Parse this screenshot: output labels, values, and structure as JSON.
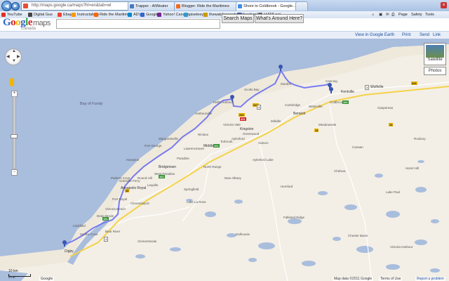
{
  "browser": {
    "address": "http://maps.google.ca/maps?hl=en&tab=wl",
    "tabs": [
      {
        "label": "Trapper - AIWeater",
        "color": "#4a78c0"
      },
      {
        "label": "Blogger: Ride the Maritimes",
        "color": "#f26b1d"
      },
      {
        "label": "Shore to Coldbrook - Google...",
        "color": "#3d8ee6"
      }
    ],
    "favorites": [
      {
        "label": "YouTube",
        "color": "#d32"
      },
      {
        "label": "Digital Gus",
        "color": "#444"
      },
      {
        "label": "Ebay",
        "color": "#e43"
      },
      {
        "label": "Instructables",
        "color": "#f90"
      },
      {
        "label": "Ride the Maritimes",
        "color": "#f60"
      },
      {
        "label": "ADV",
        "color": "#08c"
      },
      {
        "label": "Google",
        "color": "#36c"
      },
      {
        "label": "Yahoo! Canada",
        "color": "#729"
      },
      {
        "label": "pixeleey",
        "color": "#39c"
      },
      {
        "label": "thewatchersnetwork",
        "color": "#c90"
      },
      {
        "label": "facebook",
        "color": "#3b5998"
      },
      {
        "label": "kk658.net",
        "color": "#666"
      }
    ],
    "commands": [
      "Page",
      "Safety",
      "Tools"
    ]
  },
  "gmaps": {
    "logo": "Google",
    "logo_maps": "maps",
    "logo_sub": "Canada",
    "search_value": "",
    "search_button": "Search Maps",
    "around_button": "What's Around Here?",
    "links": [
      "View in Google Earth",
      "Print",
      "Send",
      "Link"
    ],
    "map_types": {
      "satellite": "Satellite",
      "photos": "Photos"
    },
    "scale_labels": [
      "10 km",
      "5 mi"
    ],
    "footer_left": "Google",
    "footer_right": "Map data ©2011 Google",
    "footer_terms": "Terms of Use",
    "footer_report": "Report a problem"
  },
  "map_labels": {
    "bay": "Bay of Fundy",
    "places": [
      "Kingston",
      "Greenwood",
      "Millville",
      "Berwick",
      "Kentville",
      "Wolfville",
      "Coldbrook",
      "Canning",
      "Morden",
      "Victoria Vale",
      "Lawrencetown",
      "Middleton",
      "Bridgetown",
      "Annapolis Royal",
      "Granville Ferry",
      "Port Royal",
      "Clementsport",
      "Deep Brook",
      "Bear River",
      "Digby",
      "Smiths Cove",
      "Lequille",
      "Paradise",
      "Springfield",
      "New Albany",
      "Dalhousie",
      "Falkland Ridge",
      "Chester Basin",
      "Victoria Harbour",
      "Aylesford",
      "Waterville",
      "Cambridge",
      "Coldbrook",
      "Scotts Bay",
      "Hall's Harbour",
      "Harbourville",
      "Margaretsville",
      "Port George",
      "Hampton",
      "Parkers Cove",
      "Victoria Beach",
      "Litchfield",
      "Clementsvale",
      "Virginia",
      "Lake La Rose",
      "Hemford",
      "Chelsea",
      "Canaan",
      "Lake Paul",
      "Hazel Hill",
      "Nictaux",
      "Torbrook",
      "Auburn",
      "Aylesford Lake",
      "North Range",
      "Brooklyn",
      "Gaspereau",
      "Meadowvale",
      "Roxbury",
      "West Paradise",
      "Round Hill"
    ],
    "highways": [
      "101",
      "101",
      "101",
      "101",
      "1",
      "1",
      "1",
      "10",
      "10",
      "12",
      "14",
      "201",
      "201",
      "221",
      "221",
      "221",
      "358",
      "359",
      "360"
    ]
  }
}
